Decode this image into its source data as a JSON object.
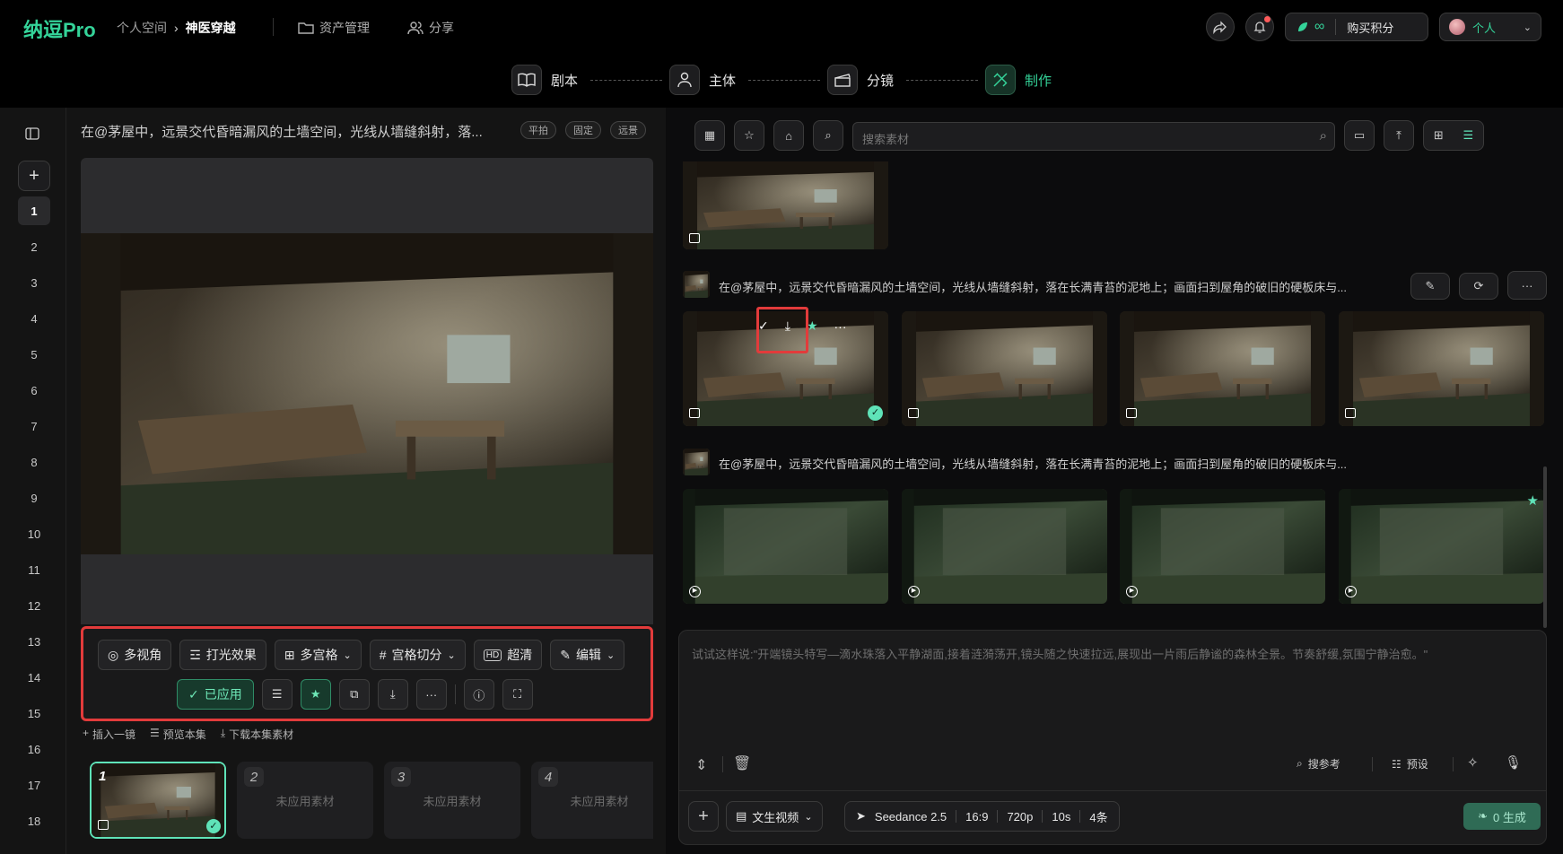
{
  "header": {
    "logo": "纳逗Pro",
    "breadcrumb_root": "个人空间",
    "breadcrumb_current": "神医穿越",
    "asset_mgmt": "资产管理",
    "share": "分享",
    "credits": "∞",
    "buy_credits": "购买积分",
    "account": "个人"
  },
  "steps": [
    {
      "label": "剧本"
    },
    {
      "label": "主体"
    },
    {
      "label": "分镜"
    },
    {
      "label": "制作"
    }
  ],
  "sidebar": {
    "numbers": [
      "1",
      "2",
      "3",
      "4",
      "5",
      "6",
      "7",
      "8",
      "9",
      "10",
      "11",
      "12",
      "13",
      "14",
      "15",
      "16",
      "17",
      "18"
    ]
  },
  "prompt_bar": {
    "text": "在@茅屋中，远景交代昏暗漏风的土墙空间，光线从墙缝斜射，落...",
    "tags": [
      "平拍",
      "固定",
      "远景"
    ]
  },
  "toolbar": {
    "row1": {
      "multi_angle": "多视角",
      "lighting": "打光效果",
      "multi_grid": "多宫格",
      "grid_split": "宫格切分",
      "hd": "超清",
      "edit": "编辑"
    },
    "applied": "已应用"
  },
  "actions": {
    "insert": "插入一镜",
    "preview": "预览本集",
    "download": "下载本集素材"
  },
  "shots": [
    {
      "num": "1",
      "label": ""
    },
    {
      "num": "2",
      "label": "未应用素材"
    },
    {
      "num": "3",
      "label": "未应用素材"
    },
    {
      "num": "4",
      "label": "未应用素材"
    }
  ],
  "right": {
    "search_placeholder": "搜索素材",
    "gen1_prompt": "在@茅屋中，远景交代昏暗漏风的土墙空间，光线从墙缝斜射，落在长满青苔的泥地上；画面扫到屋角的破旧的硬板床与...",
    "gen2_prompt": "在@茅屋中，远景交代昏暗漏风的土墙空间，光线从墙缝斜射，落在长满青苔的泥地上；画面扫到屋角的破旧的硬板床与..."
  },
  "composer": {
    "placeholder": "试试这样说:\"开端镜头特写—滴水珠落入平静湖面,接着涟漪荡开,镜头随之快速拉远,展现出一片雨后静谧的森林全景。节奏舒缓,氛围宁静治愈。\"",
    "search_ref": "搜参考",
    "preset": "预设",
    "mode": "文生视频",
    "model": "Seedance 2.5",
    "ratio": "16:9",
    "resolution": "720p",
    "duration": "10s",
    "count": "4条",
    "generate": "0 生成"
  },
  "colors": {
    "accent": "#34d399",
    "highlight_red": "#e23b3b"
  }
}
